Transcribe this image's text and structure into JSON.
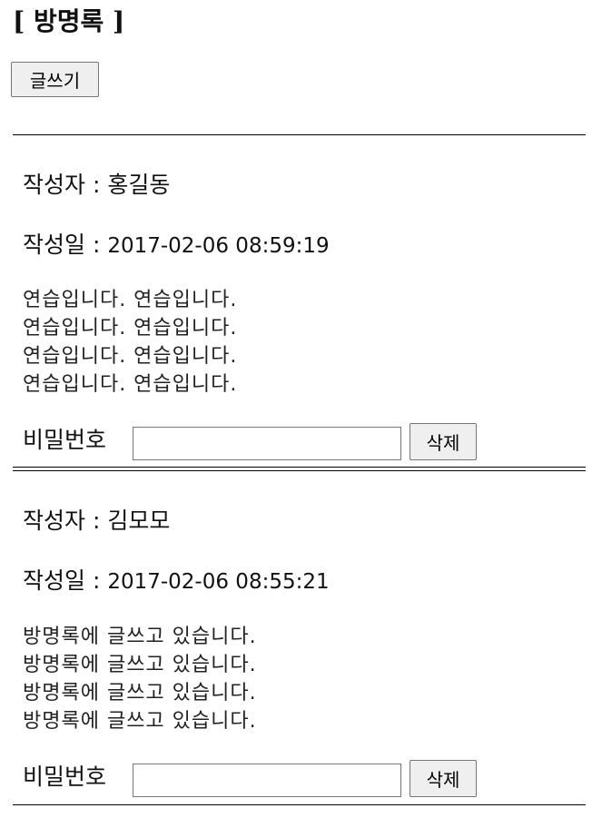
{
  "header": {
    "title": "[ 방명록 ]",
    "write_label": "글쓰기"
  },
  "entries": [
    {
      "author_label": "작성자 :",
      "author": "홍길동",
      "date_label": "작성일 :",
      "date": "2017-02-06 08:59:19",
      "content": "연습입니다. 연습입니다.\n연습입니다. 연습입니다.\n연습입니다. 연습입니다.\n연습입니다. 연습입니다.",
      "password_label": "비밀번호",
      "password_value": "",
      "delete_label": "삭제"
    },
    {
      "author_label": "작성자 :",
      "author": "김모모",
      "date_label": "작성일 :",
      "date": "2017-02-06 08:55:21",
      "content": "방명록에 글쓰고 있습니다.\n방명록에 글쓰고 있습니다.\n방명록에 글쓰고 있습니다.\n방명록에 글쓰고 있습니다.",
      "password_label": "비밀번호",
      "password_value": "",
      "delete_label": "삭제"
    }
  ]
}
